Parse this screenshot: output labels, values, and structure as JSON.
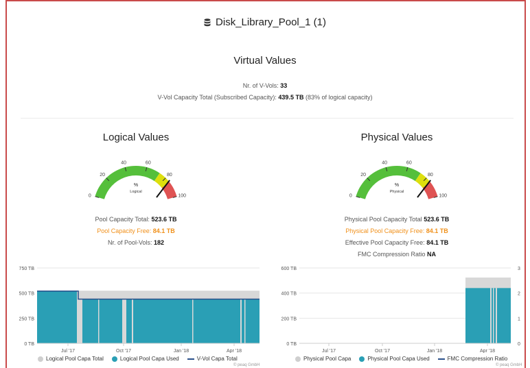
{
  "header": {
    "title": "Disk_Library_Pool_1 (1)",
    "icon": "database-icon"
  },
  "virtual": {
    "title": "Virtual Values",
    "vvols_label": "Nr. of V-Vols:",
    "vvols_value": "33",
    "capacity_label": "V-Vol Capacity Total (Subscribed Capacity):",
    "capacity_value": "439.5 TB",
    "capacity_note": "(83% of logical capacity)"
  },
  "logical": {
    "title": "Logical Values",
    "gauge": {
      "value": 84,
      "unit": "%",
      "label": "Logical",
      "ticks": [
        "0",
        "20",
        "40",
        "60",
        "80",
        "100"
      ]
    },
    "pool_total_label": "Pool Capacity Total:",
    "pool_total_value": "523.6 TB",
    "pool_free_label": "Pool Capacity Free:",
    "pool_free_value": "84.1 TB",
    "pool_vols_label": "Nr. of Pool-Vols:",
    "pool_vols_value": "182"
  },
  "physical": {
    "title": "Physical Values",
    "gauge": {
      "value": 84,
      "unit": "%",
      "label": "Physical",
      "ticks": [
        "0",
        "20",
        "40",
        "60",
        "80",
        "100"
      ]
    },
    "pool_total_label": "Physical Pool Capacity Total",
    "pool_total_value": "523.6 TB",
    "pool_free_label": "Physical Pool Capacity Free:",
    "pool_free_value": "84.1 TB",
    "effective_free_label": "Effective Pool Capacity Free:",
    "effective_free_value": "84.1 TB",
    "fmc_label": "FMC Compression Ratio",
    "fmc_value": "NA"
  },
  "colors": {
    "total": "#d8d8d8",
    "used": "#2a9fb5",
    "line": "#2a4f8a",
    "orange": "#f0901a"
  },
  "chart_data": [
    {
      "type": "area",
      "yticks": [
        "750 TB",
        "500 TB",
        "250 TB",
        "0 TB"
      ],
      "ylim": [
        0,
        750
      ],
      "xticks": [
        "Jul '17",
        "Oct '17",
        "Jan '18",
        "Apr '18"
      ],
      "series": [
        {
          "name": "Logical Pool Capa Total",
          "values": [
            523.6,
            523.6,
            523.6,
            523.6
          ]
        },
        {
          "name": "Logical Pool Capa Used",
          "values": [
            520,
            440,
            440,
            440
          ]
        },
        {
          "name": "V-Vol Capa Total",
          "values": [
            520,
            439.5,
            439.5,
            439.5
          ]
        }
      ],
      "credit": "© peaq GmbH"
    },
    {
      "type": "area",
      "yticks": [
        "600 TB",
        "400 TB",
        "200 TB",
        "0 TB"
      ],
      "ylim": [
        0,
        600
      ],
      "y2ticks": [
        "3",
        "2",
        "1",
        "0"
      ],
      "xticks": [
        "Jul '17",
        "Oct '17",
        "Jan '18",
        "Apr '18"
      ],
      "series": [
        {
          "name": "Physical Pool Capa",
          "values": [
            0,
            0,
            0,
            523.6
          ]
        },
        {
          "name": "Physical Pool Capa Used",
          "values": [
            0,
            0,
            0,
            440
          ]
        },
        {
          "name": "FMC Compression Ratio",
          "values": []
        }
      ],
      "credit": "© peaq GmbH"
    }
  ]
}
